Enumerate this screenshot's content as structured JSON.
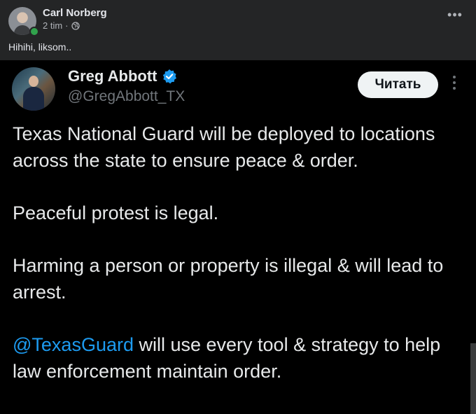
{
  "post": {
    "author": "Carl Norberg",
    "time": "2 tim",
    "dot": "·",
    "caption": "Hihihi, liksom..",
    "more_icon": "ellipsis-horizontal-icon",
    "privacy_icon": "globe-icon",
    "more_label": "•••"
  },
  "tweet": {
    "name": "Greg Abbott",
    "handle": "@GregAbbott_TX",
    "read_button": "Читать",
    "verified_icon": "verified-badge-icon",
    "paragraph1": "Texas National Guard will be deployed to locations across the state to ensure peace & order.",
    "paragraph2": "Peaceful protest is legal.",
    "paragraph3": "Harming a person or property is illegal & will lead to arrest.",
    "mention": "@TexasGuard",
    "paragraph4_rest": " will use every tool & strategy to help law enforcement maintain order."
  },
  "colors": {
    "fb_background": "#242526",
    "tweet_background": "#000000",
    "mention_blue": "#1d9bf0",
    "verified_blue": "#1d9bf0",
    "online_green": "#31a24c"
  }
}
